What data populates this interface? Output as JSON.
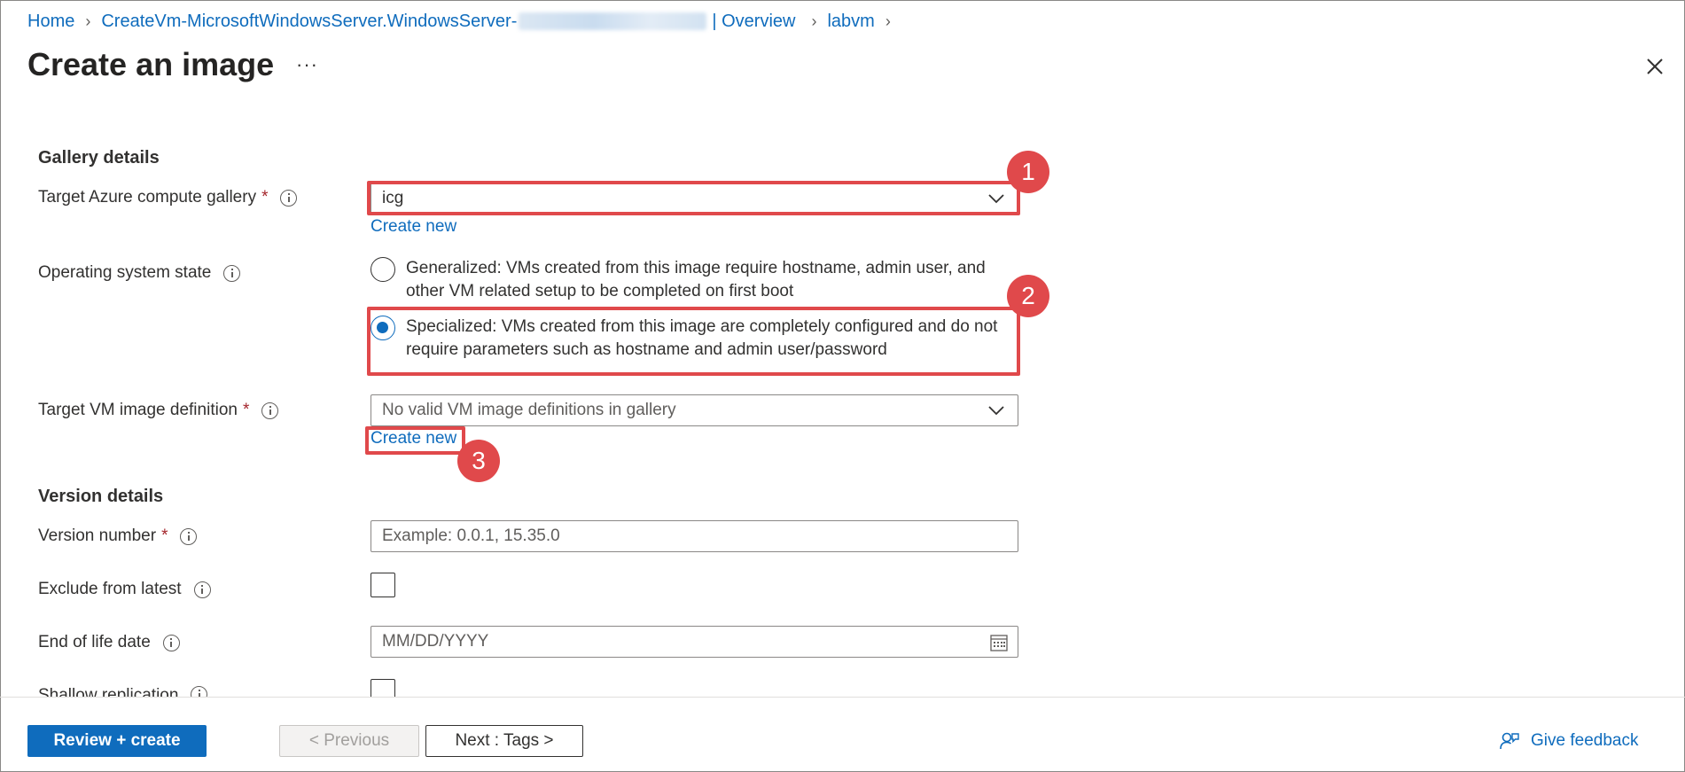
{
  "breadcrumb": {
    "home": "Home",
    "resource": "CreateVm-MicrosoftWindowsServer.WindowsServer-",
    "overview": "| Overview",
    "vm": "labvm"
  },
  "page": {
    "title": "Create an image",
    "more": "···"
  },
  "gallery": {
    "section_title": "Gallery details",
    "target_gallery_label": "Target Azure compute gallery",
    "target_gallery_value": "icg",
    "create_new": "Create new",
    "os_state_label": "Operating system state",
    "generalized_text": "Generalized: VMs created from this image require hostname, admin user, and other VM related setup to be completed on first boot",
    "specialized_text": "Specialized: VMs created from this image are completely configured and do not require parameters such as hostname and admin user/password",
    "image_def_label": "Target VM image definition",
    "image_def_placeholder": "No valid VM image definitions in gallery",
    "image_def_create_new": "Create new"
  },
  "version": {
    "section_title": "Version details",
    "version_number_label": "Version number",
    "version_number_placeholder": "Example: 0.0.1, 15.35.0",
    "exclude_label": "Exclude from latest",
    "eol_label": "End of life date",
    "eol_placeholder": "MM/DD/YYYY",
    "shallow_label": "Shallow replication"
  },
  "required_marker": "*",
  "annotations": [
    "1",
    "2",
    "3"
  ],
  "footer": {
    "review_create": "Review + create",
    "previous": "< Previous",
    "next": "Next : Tags >",
    "feedback": "Give feedback"
  },
  "colors": {
    "accent": "#0f6cbd",
    "annotation": "#e0494b",
    "required": "#a4262c"
  }
}
